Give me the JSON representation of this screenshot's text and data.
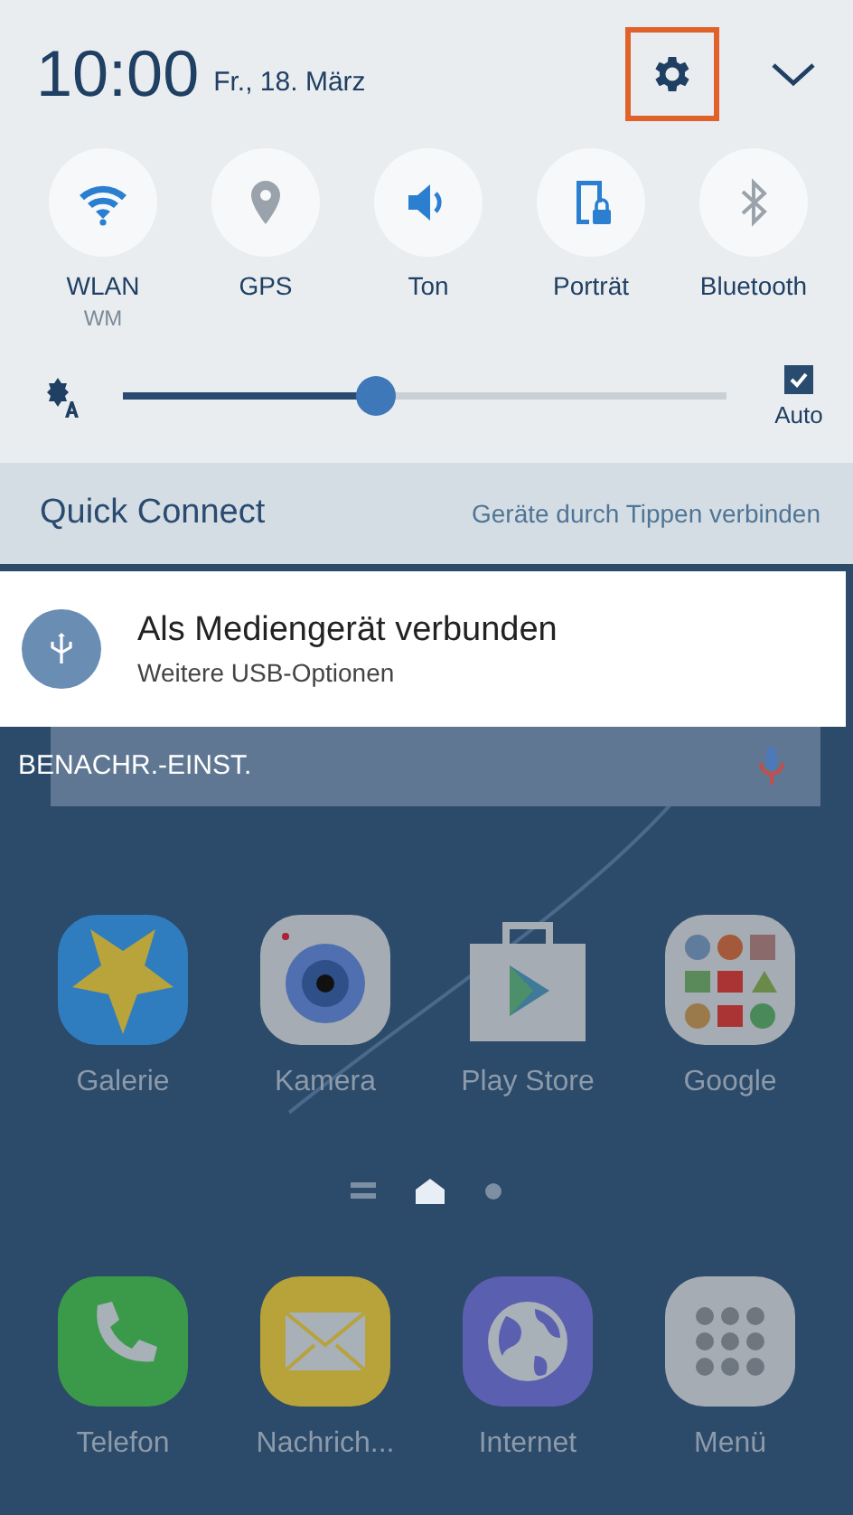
{
  "header": {
    "time": "10:00",
    "date": "Fr., 18. März",
    "settings_highlighted": true
  },
  "toggles": [
    {
      "kind": "wifi",
      "label": "WLAN",
      "sub": "WM",
      "on": true
    },
    {
      "kind": "gps",
      "label": "GPS",
      "on": false
    },
    {
      "kind": "sound",
      "label": "Ton",
      "on": true
    },
    {
      "kind": "rotation",
      "label": "Porträt",
      "on": true
    },
    {
      "kind": "bluetooth",
      "label": "Bluetooth",
      "on": false
    }
  ],
  "brightness": {
    "level": 0.42,
    "auto": {
      "label": "Auto",
      "checked": true
    }
  },
  "quick_connect": {
    "title": "Quick Connect",
    "hint": "Geräte durch Tippen verbinden"
  },
  "notification": {
    "title": "Als Mediengerät verbunden",
    "subtitle": "Weitere USB-Optionen"
  },
  "notification_settings": "BENACHR.-EINST.",
  "apps": [
    {
      "kind": "gallery",
      "label": "Galerie"
    },
    {
      "kind": "camera",
      "label": "Kamera"
    },
    {
      "kind": "store",
      "label": "Play Store"
    },
    {
      "kind": "folder",
      "label": "Google"
    }
  ],
  "page_indicators": [
    {
      "kind": "list",
      "selected": false
    },
    {
      "kind": "home",
      "selected": true
    },
    {
      "kind": "dot",
      "selected": false
    }
  ],
  "dock": [
    {
      "kind": "phone",
      "label": "Telefon"
    },
    {
      "kind": "messages",
      "label": "Nachrich..."
    },
    {
      "kind": "internet",
      "label": "Internet"
    },
    {
      "kind": "apps",
      "label": "Menü"
    }
  ]
}
